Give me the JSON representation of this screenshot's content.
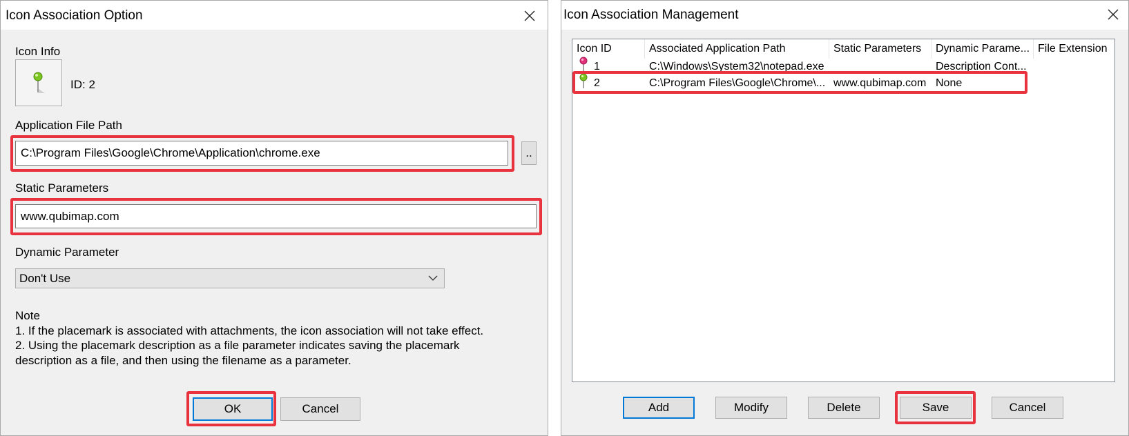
{
  "option_dialog": {
    "title": "Icon Association Option",
    "icon_info_label": "Icon Info",
    "icon_id_text": "ID: 2",
    "app_path_label": "Application File Path",
    "app_path_value": "C:\\Program Files\\Google\\Chrome\\Application\\chrome.exe",
    "browse_label": "..",
    "static_params_label": "Static Parameters",
    "static_params_value": "www.qubimap.com",
    "dynamic_param_label": "Dynamic Parameter",
    "dynamic_param_selected": "Don't Use",
    "note_title": "Note",
    "note_line1": "1. If the placemark is associated with attachments, the icon association will not take effect.",
    "note_line2": "2. Using the placemark description as a file parameter indicates saving the placemark description as a file, and then using the filename as a parameter.",
    "ok_label": "OK",
    "cancel_label": "Cancel"
  },
  "management_dialog": {
    "title": "Icon Association Management",
    "columns": [
      "Icon ID",
      "Associated Application Path",
      "Static Parameters",
      "Dynamic Parame...",
      "File Extension"
    ],
    "rows": [
      {
        "id": "1",
        "path": "C:\\Windows\\System32\\notepad.exe",
        "static": "",
        "dynamic": "Description Cont...",
        "ext": "",
        "pin_color": "#e0307a"
      },
      {
        "id": "2",
        "path": "C:\\Program Files\\Google\\Chrome\\...",
        "static": "www.qubimap.com",
        "dynamic": "None",
        "ext": "",
        "pin_color": "#7cc420"
      }
    ],
    "buttons": {
      "add": "Add",
      "modify": "Modify",
      "delete": "Delete",
      "save": "Save",
      "cancel": "Cancel"
    }
  },
  "colors": {
    "highlight": "#e8333f",
    "default_button_border": "#0078d7"
  },
  "icons": [
    "close-icon",
    "pin-icon",
    "chevron-down-icon"
  ]
}
